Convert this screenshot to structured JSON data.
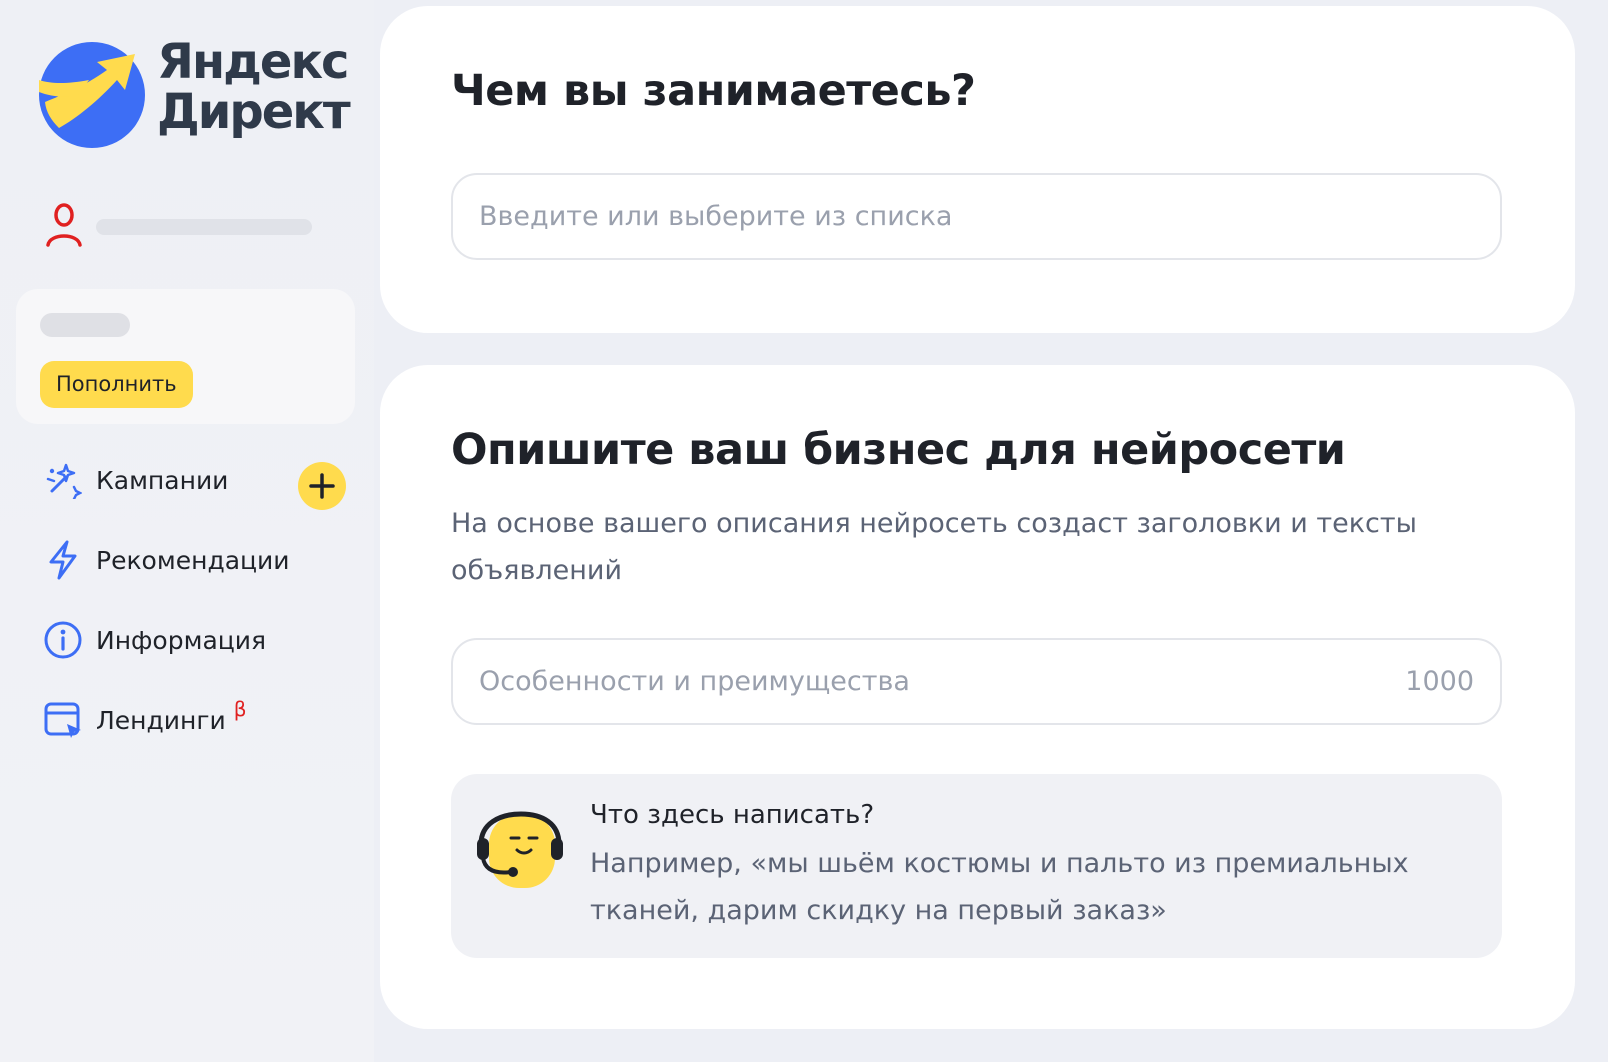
{
  "logo": {
    "line1": "Яндекс",
    "line2": "Директ",
    "colors": {
      "blue": "#3d6ef5",
      "yellow": "#ffdb4d"
    }
  },
  "user": {
    "icon": "user-icon"
  },
  "balance": {
    "topup_label": "Пополнить"
  },
  "nav": {
    "items": [
      {
        "label": "Кампании",
        "icon": "campaigns-sparkle-icon"
      },
      {
        "label": "Рекомендации",
        "icon": "lightning-icon"
      },
      {
        "label": "Информация",
        "icon": "info-icon"
      },
      {
        "label": "Лендинги",
        "icon": "landing-page-icon",
        "badge": "β"
      }
    ],
    "add_icon": "plus-icon"
  },
  "business": {
    "title": "Чем вы занимаетесь?",
    "placeholder": "Введите или выберите из списка"
  },
  "describe": {
    "title": "Опишите ваш бизнес для нейросети",
    "subtitle": "На основе вашего описания нейросеть создаст заголовки и тексты объявлений",
    "placeholder": "Особенности и преимущества",
    "counter": "1000",
    "hint": {
      "title": "Что здесь написать?",
      "text": "Например, «мы шьём костюмы и пальто из премиальных тканей, дарим скидку на первый заказ»",
      "icon": "support-assistant-icon"
    }
  },
  "colors": {
    "accent_yellow": "#ffdb4d",
    "nav_icon_blue": "#3d6ef5",
    "user_icon_red": "#e02020"
  }
}
